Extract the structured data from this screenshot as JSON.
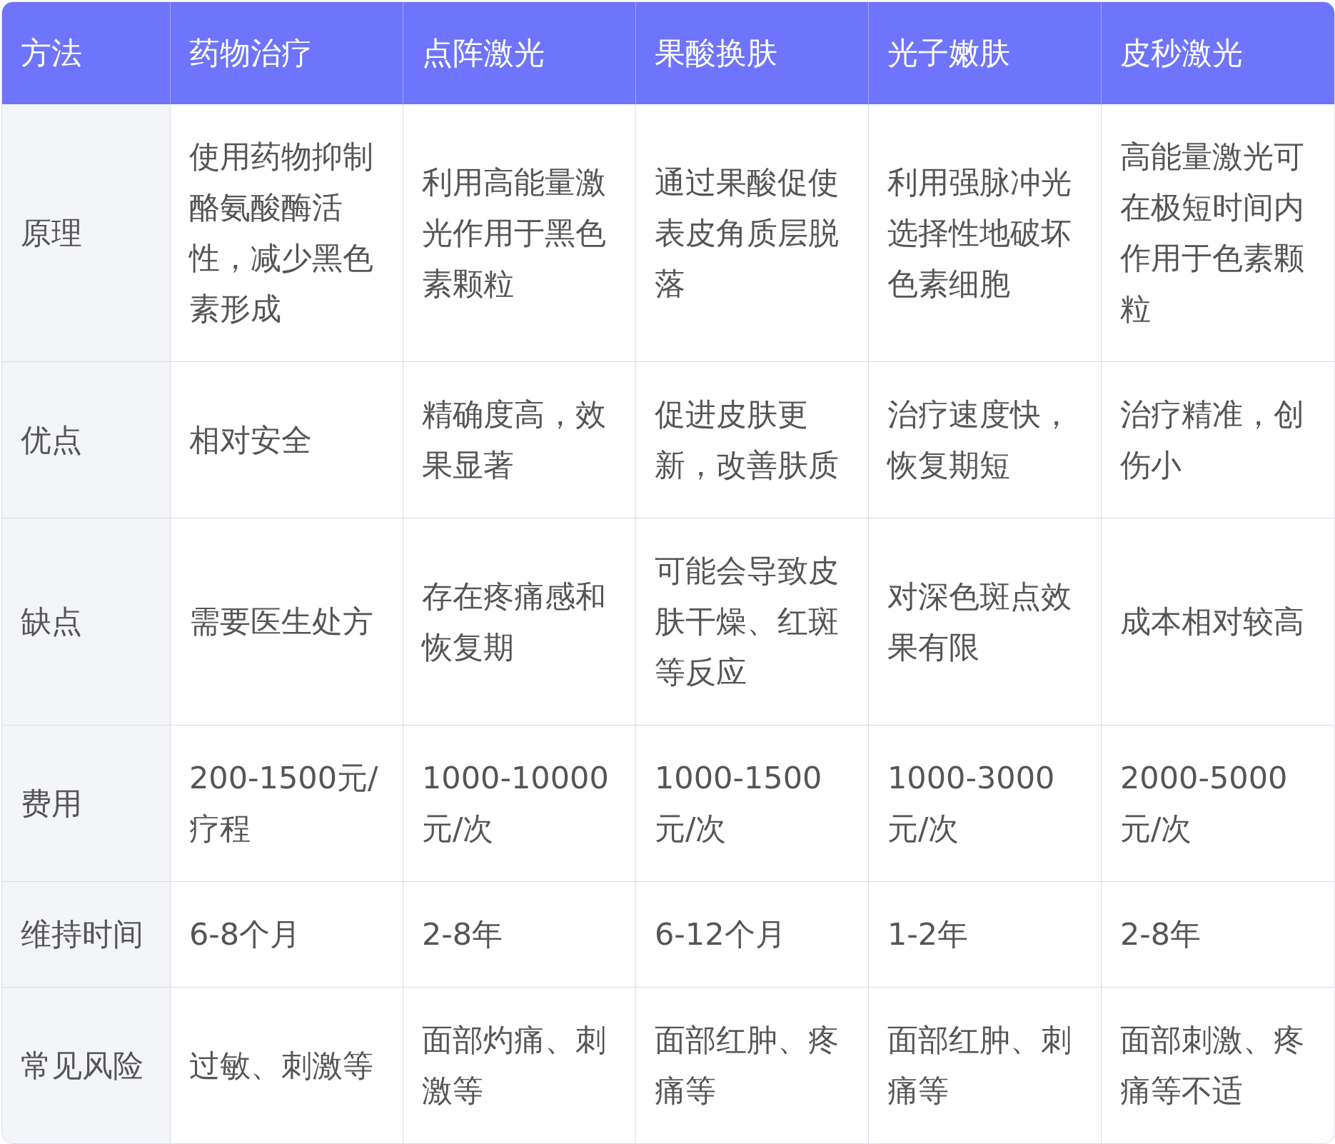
{
  "table": {
    "columns": [
      "方法",
      "药物治疗",
      "点阵激光",
      "果酸换肤",
      "光子嫩肤",
      "皮秒激光"
    ],
    "rows": [
      {
        "cells": [
          "原理",
          "使用药物抑制酪氨酸酶活性，减少黑色素形成",
          "利用高能量激光作用于黑色素颗粒",
          "通过果酸促使表皮角质层脱落",
          "利用强脉冲光选择性地破坏色素细胞",
          "高能量激光可在极短时间内作用于色素颗粒"
        ]
      },
      {
        "cells": [
          "优点",
          "相对安全",
          "精确度高，效果显著",
          "促进皮肤更新，改善肤质",
          "治疗速度快，恢复期短",
          "治疗精准，创伤小"
        ]
      },
      {
        "cells": [
          "缺点",
          "需要医生处方",
          "存在疼痛感和恢复期",
          "可能会导致皮肤干燥、红斑等反应",
          "对深色斑点效果有限",
          "成本相对较高"
        ]
      },
      {
        "cells": [
          "费用",
          "200-1500元/疗程",
          "1000-10000元/次",
          "1000-1500元/次",
          "1000-3000元/次",
          "2000-5000元/次"
        ]
      },
      {
        "cells": [
          "维持时间",
          "6-8个月",
          "2-8年",
          "6-12个月",
          "1-2年",
          "2-8年"
        ]
      },
      {
        "cells": [
          "常见风险",
          "过敏、刺激等",
          "面部灼痛、刺激等",
          "面部红肿、疼痛等",
          "面部红肿、刺痛等",
          "面部刺激、疼痛等不适"
        ]
      }
    ]
  }
}
